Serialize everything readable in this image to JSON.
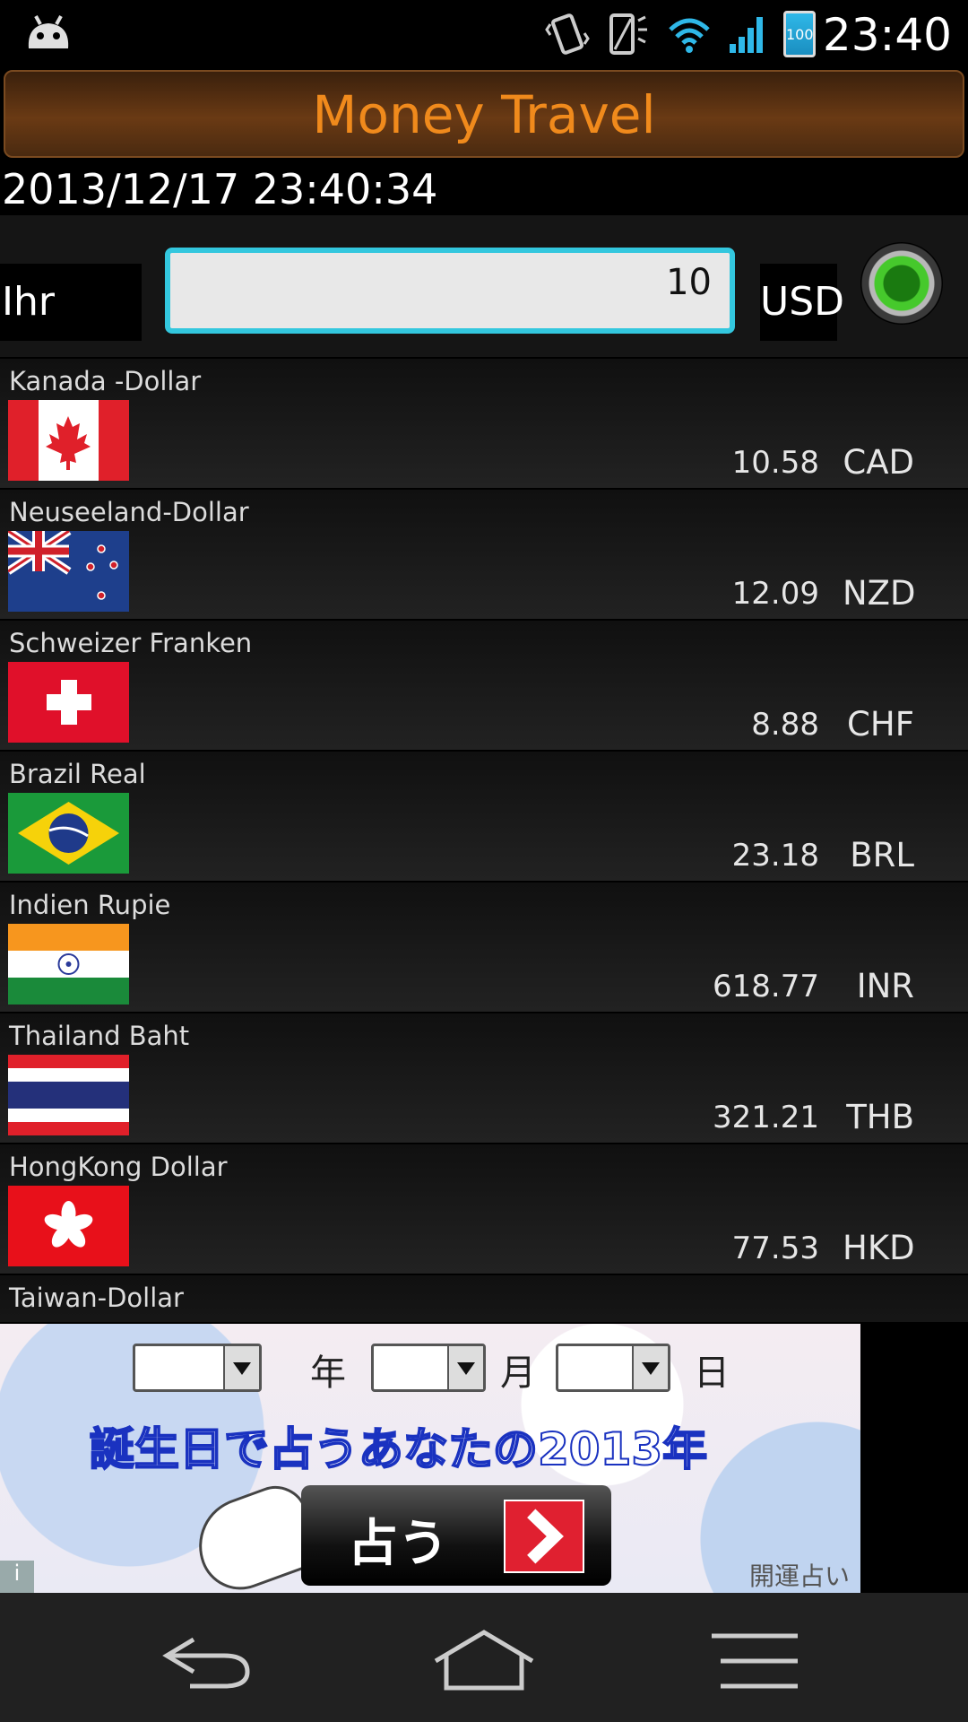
{
  "status_bar": {
    "time": "23:40",
    "battery": "100",
    "icons": [
      "android-icon",
      "vibrate-icon",
      "phone-signal-icon",
      "wifi-icon",
      "cell-signal-icon",
      "battery-icon"
    ]
  },
  "app": {
    "title": "Money Travel",
    "title_color": "#f08a1c",
    "datetime": "2013/12/17 23:40:34"
  },
  "amount": {
    "label": "Ihr Geld",
    "value": "10",
    "currency": "USD",
    "accent": "#33c7de"
  },
  "currencies": [
    {
      "name": "Kanada -Dollar",
      "value": "10.58",
      "code": "CAD",
      "flag": "canada-flag"
    },
    {
      "name": "Neuseeland-Dollar",
      "value": "12.09",
      "code": "NZD",
      "flag": "new-zealand-flag"
    },
    {
      "name": "Schweizer Franken",
      "value": "8.88",
      "code": "CHF",
      "flag": "switzerland-flag"
    },
    {
      "name": "Brazil Real",
      "value": "23.18",
      "code": "BRL",
      "flag": "brazil-flag"
    },
    {
      "name": "Indien Rupie",
      "value": "618.77",
      "code": "INR",
      "flag": "india-flag"
    },
    {
      "name": "Thailand Baht",
      "value": "321.21",
      "code": "THB",
      "flag": "thailand-flag"
    },
    {
      "name": "HongKong Dollar",
      "value": "77.53",
      "code": "HKD",
      "flag": "hong-kong-flag"
    },
    {
      "name": "Taiwan-Dollar",
      "value": "",
      "code": "",
      "flag": "taiwan-flag"
    }
  ],
  "ad": {
    "year_unit": "年",
    "month_unit": "月",
    "day_unit": "日",
    "headline": "誕生日で占うあなたの2013年",
    "button_label": "占う",
    "footer": "開運占い",
    "info": "i"
  },
  "nav": {
    "icons": [
      "back-icon",
      "home-icon",
      "menu-icon"
    ]
  }
}
